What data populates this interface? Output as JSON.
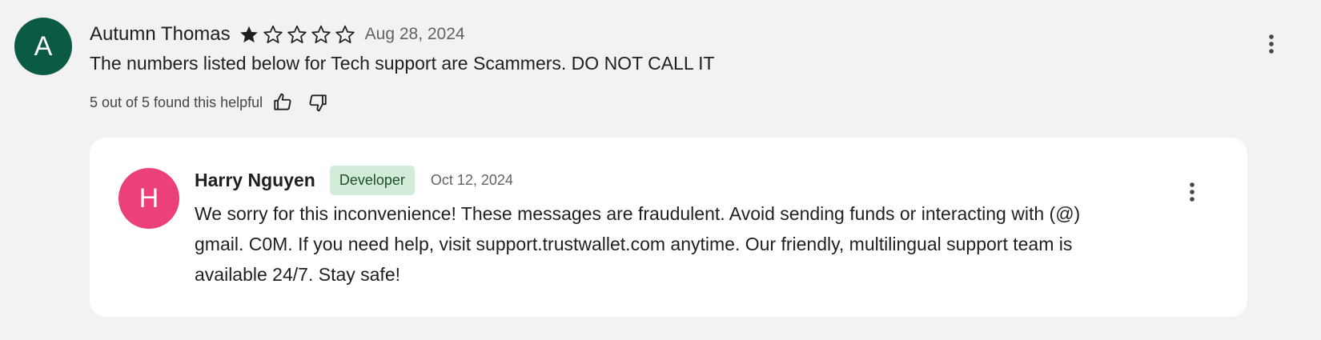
{
  "review": {
    "avatar_letter": "A",
    "avatar_color": "#0b5a45",
    "author": "Autumn Thomas",
    "rating": 1,
    "max_rating": 5,
    "date": "Aug 28, 2024",
    "text": "The numbers listed below for Tech support are Scammers. DO NOT CALL IT",
    "helpful_text": "5 out of 5 found this helpful",
    "thumbs_up_icon": "thumbs-up-icon",
    "thumbs_down_icon": "thumbs-down-icon",
    "more_icon": "more-vert-icon"
  },
  "reply": {
    "avatar_letter": "H",
    "avatar_color": "#ec407a",
    "author": "Harry Nguyen",
    "badge": "Developer",
    "badge_color": "#d2ecd9",
    "date": "Oct 12, 2024",
    "text": "We sorry for this inconvenience! These messages are fraudulent. Avoid sending funds or interacting with (@) gmail. C0M. If you need help, visit support.trustwallet.com anytime. Our friendly, multilingual support team is available 24/7. Stay safe!",
    "more_icon": "more-vert-icon"
  },
  "colors": {
    "background": "#f1f2f1",
    "star_fill": "#1f1f1f"
  }
}
